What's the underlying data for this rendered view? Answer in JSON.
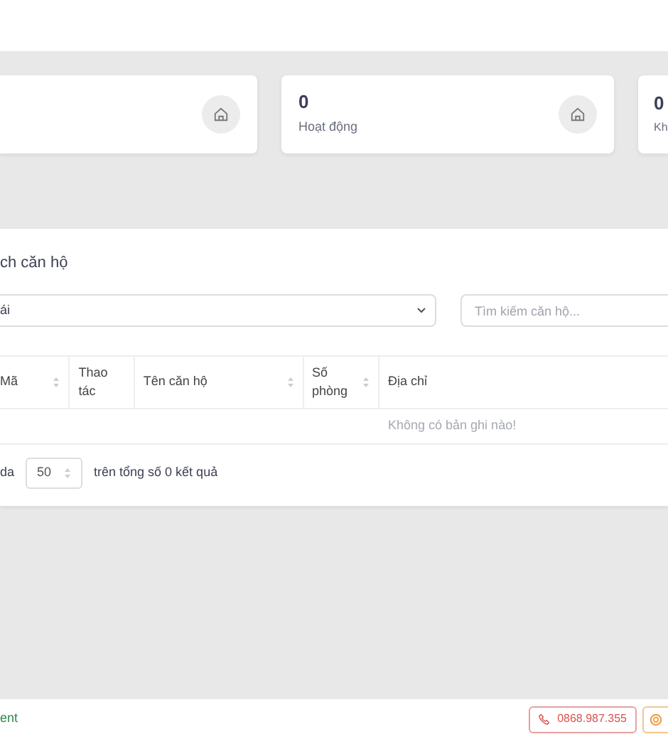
{
  "stats": [
    {
      "has_icon": true
    },
    {
      "value": "0",
      "label": "Hoạt động",
      "has_icon": true
    },
    {
      "value": "0",
      "label": "Kh",
      "has_icon": false
    }
  ],
  "panel": {
    "title": "ch căn hộ",
    "filter": {
      "value": "ái"
    },
    "search": {
      "placeholder": "Tìm kiếm căn hộ..."
    },
    "table": {
      "columns": [
        {
          "label": "Mã",
          "sortable": true
        },
        {
          "label": "Thao tác",
          "sortable": false
        },
        {
          "label": "Tên căn hộ",
          "sortable": true
        },
        {
          "label": "Số phòng",
          "sortable": true
        },
        {
          "label": "Địa chỉ",
          "sortable": false
        }
      ],
      "empty_text": "Không có bản ghi nào!"
    },
    "pagination": {
      "prefix": "da",
      "page_size": "50",
      "summary": "trên tổng số 0 kết quả"
    }
  },
  "footer": {
    "brand": "ent",
    "phone": "0868.987.355"
  }
}
